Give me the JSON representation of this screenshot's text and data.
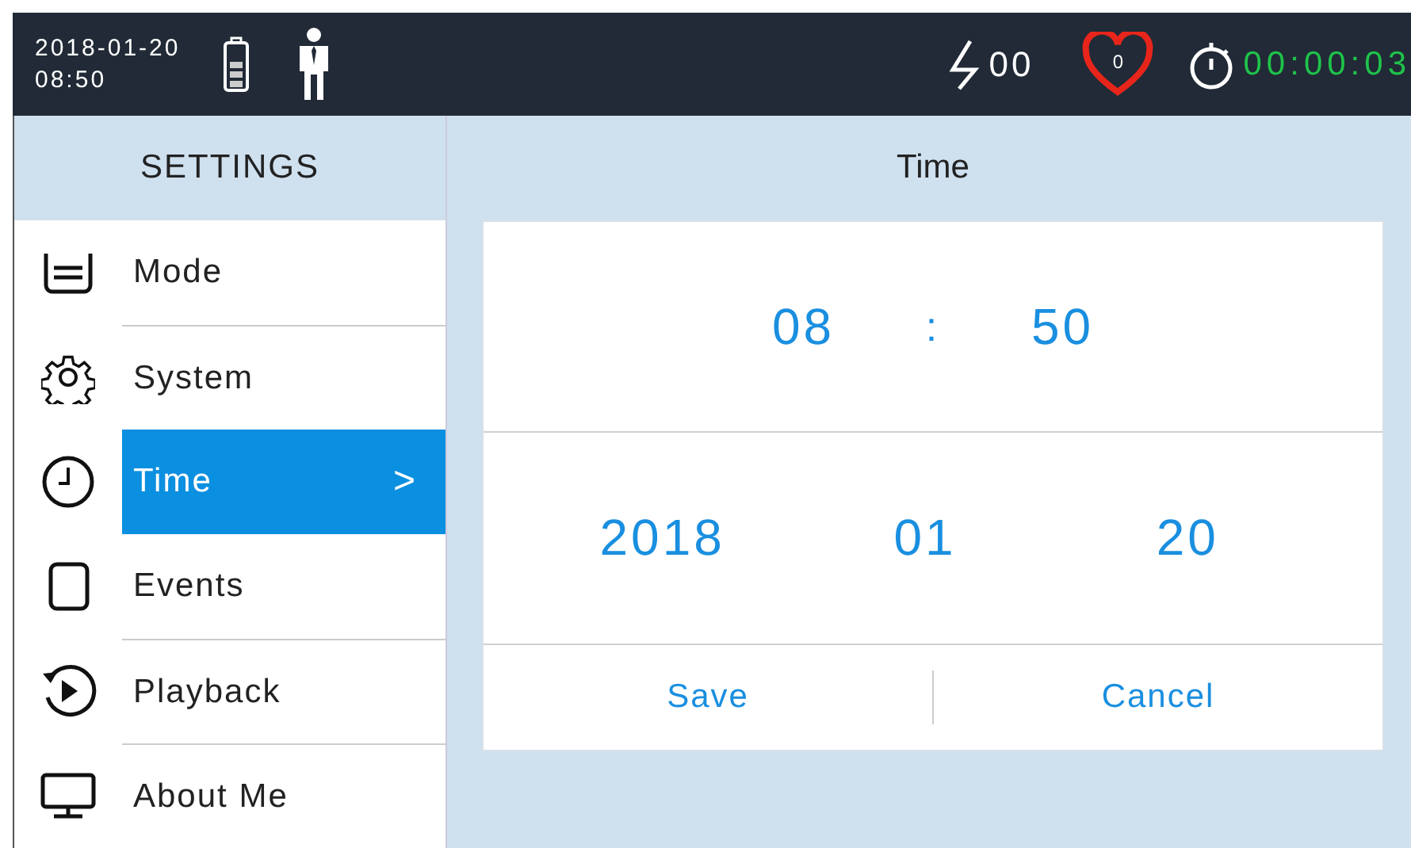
{
  "status_bar": {
    "date": "2018-01-20",
    "time": "08:50",
    "shock_count": "00",
    "heart_rate": "0",
    "timer": "00:00:03"
  },
  "sidebar": {
    "title": "SETTINGS",
    "items": [
      {
        "label": "Mode",
        "kind": "mode",
        "selected": false
      },
      {
        "label": "System",
        "kind": "system",
        "selected": false
      },
      {
        "label": "Time",
        "kind": "time",
        "selected": true,
        "arrow": ">"
      },
      {
        "label": "Events",
        "kind": "events",
        "selected": false
      },
      {
        "label": "Playback",
        "kind": "playback",
        "selected": false
      },
      {
        "label": "About Me",
        "kind": "about",
        "selected": false
      }
    ]
  },
  "panel": {
    "title": "Time",
    "hour": "08",
    "separator": ":",
    "minute": "50",
    "year": "2018",
    "month": "01",
    "day": "20",
    "buttons": [
      "Save",
      "Cancel"
    ]
  }
}
